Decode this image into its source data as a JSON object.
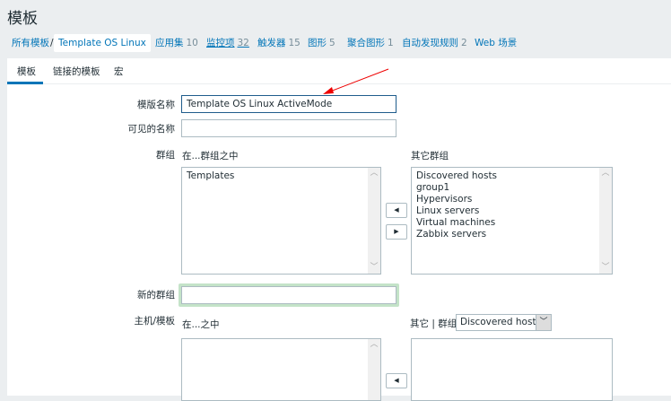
{
  "title": "模板",
  "breadcrumb": {
    "all": "所有模板",
    "sep": "/",
    "current": "Template OS Linux"
  },
  "nav": [
    {
      "label": "应用集",
      "count": "10"
    },
    {
      "label": "监控项",
      "count": "32"
    },
    {
      "label": "触发器",
      "count": "15"
    },
    {
      "label": "图形",
      "count": "5"
    },
    {
      "label": "聚合图形",
      "count": "1"
    },
    {
      "label": "自动发现规则",
      "count": "2"
    },
    {
      "label": "Web 场景",
      "count": ""
    }
  ],
  "tabs": [
    "模板",
    "链接的模板",
    "宏"
  ],
  "form": {
    "name_label": "模版名称",
    "name_value": "Template OS Linux ActiveMode",
    "visible_label": "可见的名称",
    "visible_value": "",
    "groups_label": "群组",
    "in_groups": "在...群组之中",
    "other_groups": "其它群组",
    "selected_groups": [
      "Templates"
    ],
    "available_groups": [
      "Discovered hosts",
      "group1",
      "Hypervisors",
      "Linux servers",
      "Virtual machines",
      "Zabbix servers"
    ],
    "new_group_label": "新的群组",
    "new_group_value": "",
    "hosts_label": "主机/模板",
    "in_hosts": "在...之中",
    "other_hosts": "其它 | 群组",
    "group_select": "Discovered hosts"
  }
}
